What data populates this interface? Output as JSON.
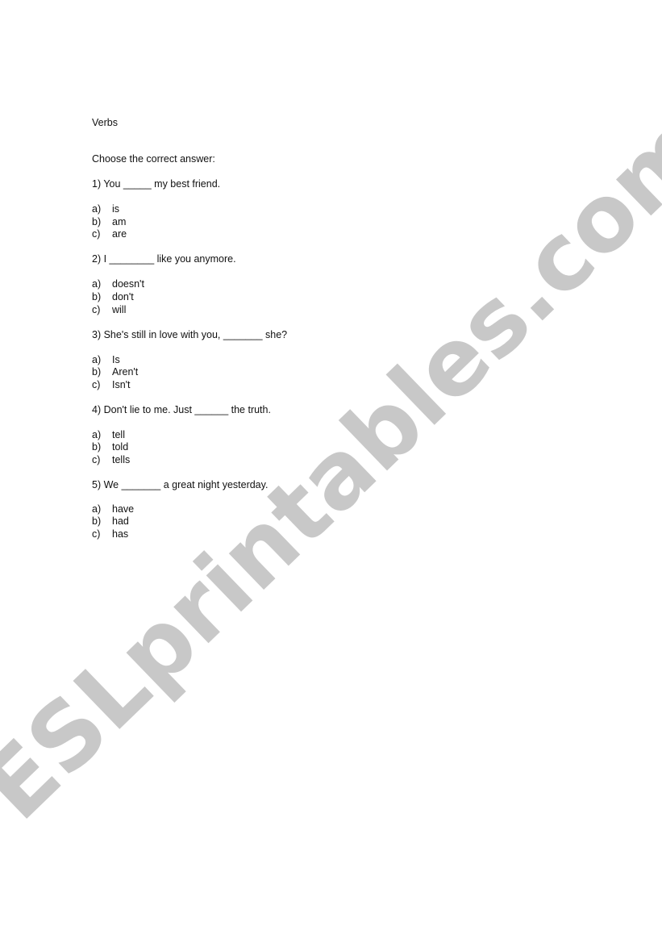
{
  "watermark": {
    "text": "ESLprintables.com",
    "color": "#c8c8c8"
  },
  "title": "Verbs",
  "instructions": "Choose the correct answer:",
  "questions": [
    {
      "prompt": "1) You _____ my best friend.",
      "options": [
        {
          "letter": "a)",
          "text": "is"
        },
        {
          "letter": "b)",
          "text": "am"
        },
        {
          "letter": "c)",
          "text": "are"
        }
      ]
    },
    {
      "prompt": "2) I ________ like you anymore.",
      "options": [
        {
          "letter": "a)",
          "text": "doesn't"
        },
        {
          "letter": "b)",
          "text": "don't"
        },
        {
          "letter": "c)",
          "text": "will"
        }
      ]
    },
    {
      "prompt": "3) She's still in love with you, _______ she?",
      "options": [
        {
          "letter": "a)",
          "text": "Is"
        },
        {
          "letter": "b)",
          "text": "Aren't"
        },
        {
          "letter": "c)",
          "text": "Isn't"
        }
      ]
    },
    {
      "prompt": "4) Don't lie to me. Just ______ the truth.",
      "options": [
        {
          "letter": "a)",
          "text": "tell"
        },
        {
          "letter": "b)",
          "text": "told"
        },
        {
          "letter": "c)",
          "text": "tells"
        }
      ]
    },
    {
      "prompt": "5) We _______ a great night yesterday.",
      "options": [
        {
          "letter": "a)",
          "text": "have"
        },
        {
          "letter": "b)",
          "text": "had"
        },
        {
          "letter": "c)",
          "text": "has"
        }
      ]
    }
  ]
}
